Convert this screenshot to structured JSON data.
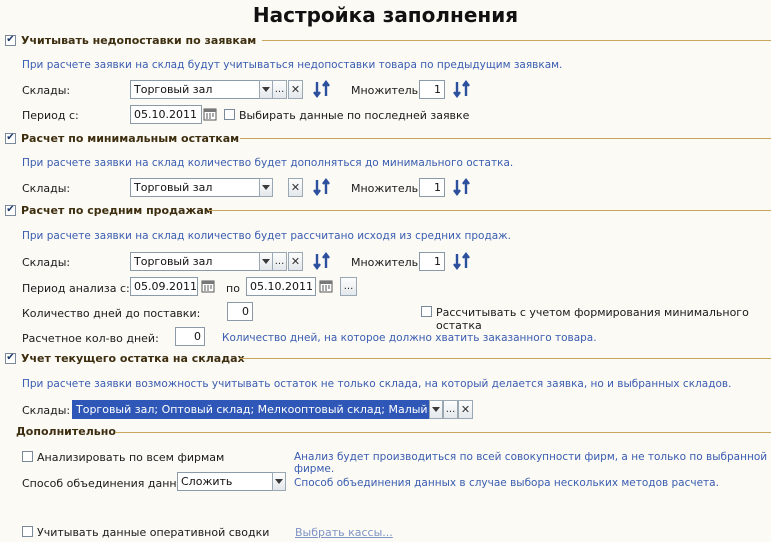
{
  "title": "Настройка заполнения",
  "sec1": {
    "label": "Учитывать недопоставки по заявкам",
    "info": "При расчете заявки на склад будут учитываться недопоставки товара по предыдущим заявкам.",
    "warehouses_label": "Склады:",
    "warehouse_value": "Торговый зал",
    "multiplier_label": "Множитель:",
    "multiplier_value": "1",
    "period_label": "Период с:",
    "period_value": "05.10.2011",
    "last_request_label": "Выбирать данные по последней заявке"
  },
  "sec2": {
    "label": "Расчет по минимальным остаткам",
    "info": "При расчете заявки на склад количество будет дополняться до минимального остатка.",
    "warehouses_label": "Склады:",
    "warehouse_value": "Торговый зал",
    "multiplier_label": "Множитель:",
    "multiplier_value": "1"
  },
  "sec3": {
    "label": "Расчет по средним продажам",
    "info": "При расчете заявки на склад количество будет рассчитано исходя из средних продаж.",
    "warehouses_label": "Склады:",
    "warehouse_value": "Торговый зал",
    "multiplier_label": "Множитель:",
    "multiplier_value": "1",
    "analysis_label": "Период анализа с:",
    "date_from": "05.09.2011",
    "to_label": "по",
    "date_to": "05.10.2011",
    "ellipsis": "...",
    "days_delivery_label": "Количество дней до поставки:",
    "days_delivery_value": "0",
    "min_stock_label": "Рассчитывать с учетом формирования минимального остатка",
    "calc_days_label": "Расчетное кол-во дней:",
    "calc_days_value": "0",
    "calc_days_info": "Количество дней, на которое должно хватить заказанного товара."
  },
  "sec4": {
    "label": "Учет текущего остатка на складах",
    "info": "При расчете заявки возможность учитывать остаток не только склада, на который делается заявка, но и выбранных складов.",
    "warehouses_label": "Склады:",
    "warehouses_value": "Торговый зал; Оптовый склад; Мелкооптовый склад; Малый торгов"
  },
  "extra": {
    "heading": "Дополнительно",
    "all_firms_label": "Анализировать по всем фирмам",
    "all_firms_info": "Анализ будет производиться по всей совокупности фирм, а не только по выбранной фирме.",
    "merge_label": "Способ объединения данных:",
    "merge_value": "Сложить",
    "merge_info": "Способ объединения данных в случае выбора нескольких методов расчета.",
    "operative_label": "Учитывать данные оперативной сводки",
    "cash_link": "Выбрать кассы..."
  },
  "check_glyph": "✔",
  "ellipsis": "...",
  "clear_glyph": "✕",
  "colors": {
    "section_line": "#c9a75a",
    "info_text": "#3a5cb0",
    "sort_icon": "#2c4f9e"
  }
}
